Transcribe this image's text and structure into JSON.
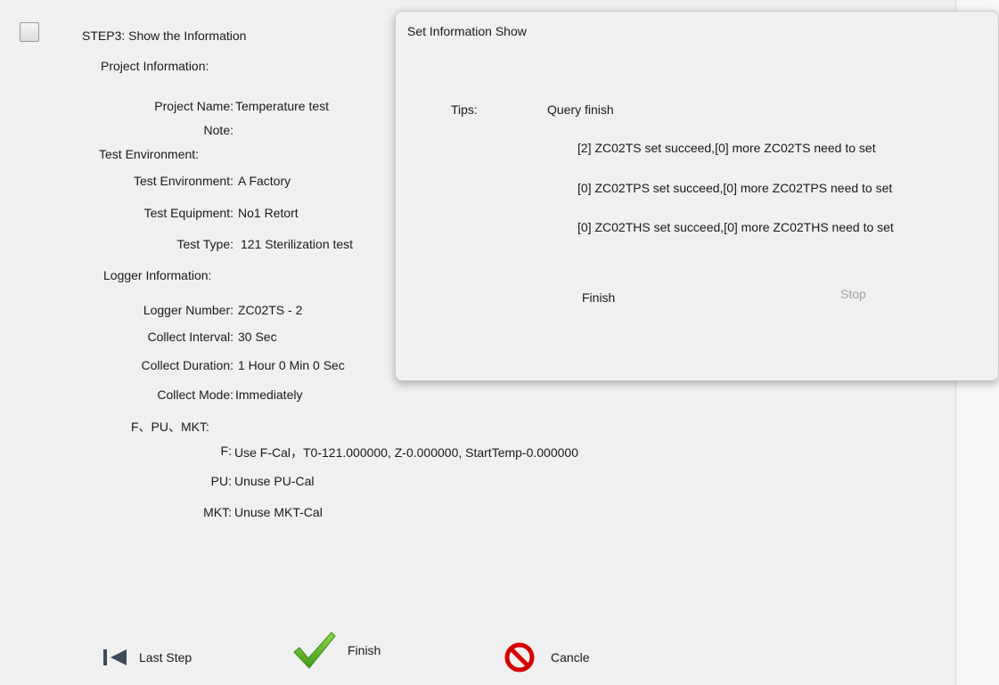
{
  "step": {
    "title": "STEP3:  Show the Information"
  },
  "project": {
    "heading": "Project Information:",
    "name_label": "Project Name:",
    "name_value": "Temperature test",
    "note_label": "Note:",
    "note_value": ""
  },
  "environment": {
    "heading": "Test Environment:",
    "env_label": "Test Environment:",
    "env_value": "A Factory",
    "equipment_label": "Test Equipment:",
    "equipment_value": "No1 Retort",
    "type_label": "Test Type:",
    "type_value": "121 Sterilization test"
  },
  "logger": {
    "heading": "Logger Information:",
    "number_label": "Logger Number:",
    "number_value": "ZC02TS - 2",
    "interval_label": "Collect Interval:",
    "interval_value": "30 Sec",
    "duration_label": "Collect Duration:",
    "duration_value": "1 Hour 0 Min 0 Sec",
    "mode_label": "Collect Mode:",
    "mode_value": "Immediately"
  },
  "calc": {
    "heading": "F、PU、MKT:",
    "f_label": "F:",
    "f_value": "Use F-Cal，T0-121.000000, Z-0.000000, StartTemp-0.000000",
    "pu_label": "PU:",
    "pu_value": "Unuse PU-Cal",
    "mkt_label": "MKT:",
    "mkt_value": "Unuse MKT-Cal"
  },
  "toolbar": {
    "last_step": "Last Step",
    "finish": "Finish",
    "cancel": "Cancle"
  },
  "dialog": {
    "title": "Set Information Show",
    "tips_label": "Tips:",
    "status": "Query finish",
    "lines": [
      "[2] ZC02TS set succeed,[0] more ZC02TS need to set",
      "[0] ZC02TPS set succeed,[0] more ZC02TPS need to set",
      "[0] ZC02THS set succeed,[0] more ZC02THS need to set"
    ],
    "finish_button": "Finish",
    "stop_button": "Stop"
  },
  "icons": {
    "last_step": "skip-back-icon",
    "finish": "checkmark-icon",
    "cancel": "no-entry-icon"
  },
  "colors": {
    "check_green": "#5ab52a",
    "cancel_red": "#d40000",
    "disabled_text": "#a0a0a0"
  }
}
